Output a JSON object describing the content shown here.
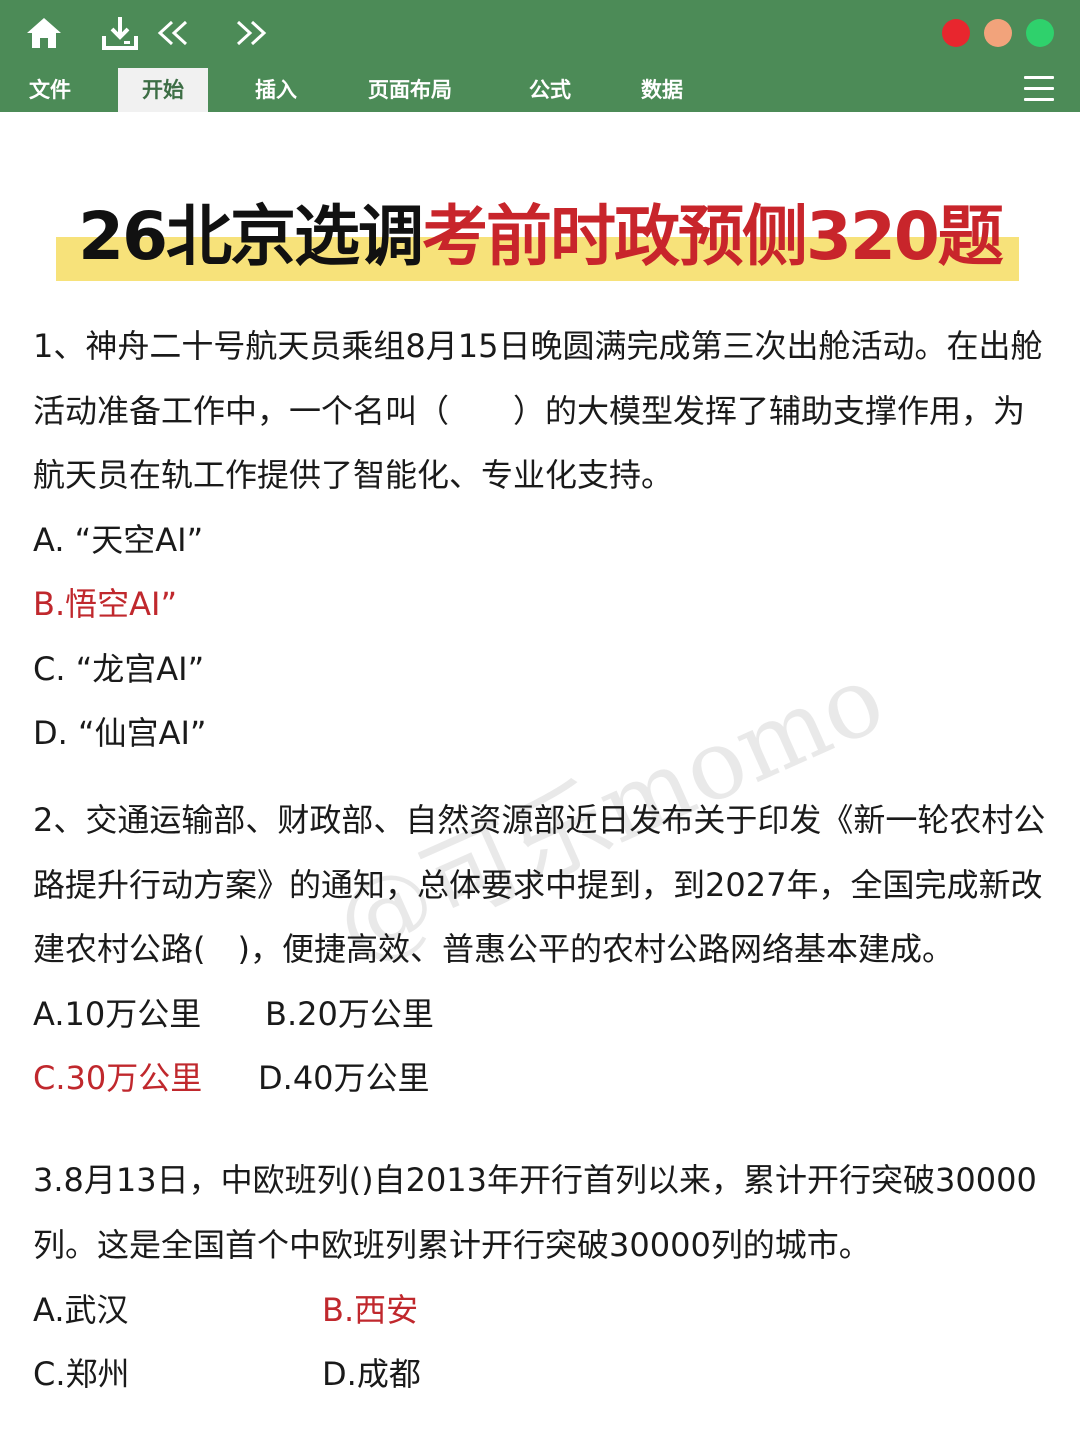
{
  "tabs": [
    "文件",
    "开始",
    "插入",
    "页面布局",
    "公式",
    "数据"
  ],
  "active_tab": "开始",
  "toolbar": {
    "back_glyph": "<<",
    "forward_glyph": ">>"
  },
  "title": {
    "part1": "26北京选调",
    "part2": "考前时政预侧320题"
  },
  "watermark": "@可乐momo",
  "questions": [
    {
      "stem": "1、神舟二十号航天员乘组8月15日晚圆满完成第三次出舱活动。在出舱活动准备工作中，一个名叫（　　）的大模型发挥了辅助支撑作用，为航天员在轨工作提供了智能化、专业化支持。",
      "options": [
        {
          "text": "A. “天空AI”",
          "correct": false
        },
        {
          "text": "B.悟空AI”",
          "correct": true
        },
        {
          "text": "C. “龙宫AI”",
          "correct": false
        },
        {
          "text": "D. “仙宫AI”",
          "correct": false
        }
      ]
    },
    {
      "stem": "2、交通运输部、财政部、自然资源部近日发布关于印发《新一轮农村公路提升行动方案》的通知，总体要求中提到，到2027年，全国完成新改建农村公路(　)，便捷高效、普惠公平的农村公路网络基本建成。",
      "options": [
        {
          "text": "A.10万公里",
          "correct": false
        },
        {
          "text": "B.20万公里",
          "correct": false
        },
        {
          "text": "C.30万公里",
          "correct": true
        },
        {
          "text": "D.40万公里",
          "correct": false
        }
      ]
    },
    {
      "stem": "3.8月13日，中欧班列()自2013年开行首列以来，累计开行突破30000列。这是全国首个中欧班列累计开行突破30000列的城市。",
      "options": [
        {
          "text": "A.武汉",
          "correct": false
        },
        {
          "text": "B.西安",
          "correct": true
        },
        {
          "text": "C.郑州",
          "correct": false
        },
        {
          "text": "D.成都",
          "correct": false
        }
      ]
    }
  ],
  "colors": {
    "toolbar_green": "#4c8b57",
    "correct_red": "#c0282d",
    "title_red": "#c8252b",
    "highlight_yellow": "#f7e27a"
  }
}
